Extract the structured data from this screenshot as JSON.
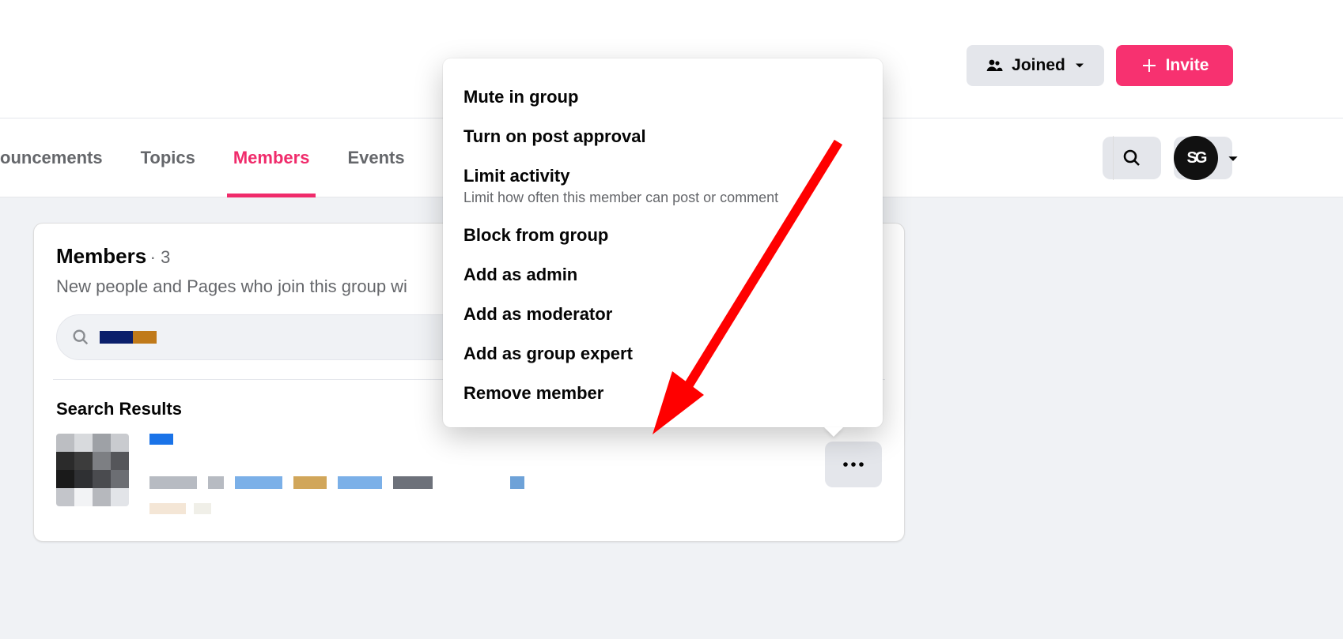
{
  "header": {
    "joined_label": "Joined",
    "invite_label": "Invite"
  },
  "tabs": {
    "announcements": "ouncements",
    "topics": "Topics",
    "members": "Members",
    "events": "Events"
  },
  "account": {
    "initials": "SG"
  },
  "members_card": {
    "title": "Members",
    "count_prefix": " · ",
    "count": "3",
    "subtitle": "New people and Pages who join this group wi",
    "search_results_label": "Search Results"
  },
  "menu": {
    "mute": "Mute in group",
    "post_approval": "Turn on post approval",
    "limit_title": "Limit activity",
    "limit_sub": "Limit how often this member can post or comment",
    "block": "Block from group",
    "add_admin": "Add as admin",
    "add_mod": "Add as moderator",
    "add_expert": "Add as group expert",
    "remove": "Remove member"
  }
}
